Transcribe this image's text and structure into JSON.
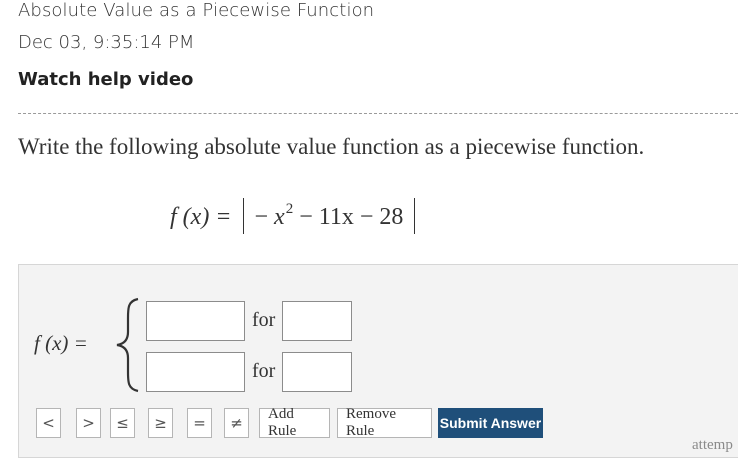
{
  "header": {
    "title": "Absolute Value as a Piecewise Function",
    "timestamp": "Dec 03, 9:35:14 PM",
    "help_link": "Watch help video"
  },
  "question": {
    "instruction": "Write the following absolute value function as a piecewise function.",
    "function_lhs": "f (x) =",
    "abs_minus": "−",
    "abs_x": "x",
    "abs_exp": "2",
    "abs_rest": "− 11x − 28"
  },
  "answer": {
    "lhs": "f (x) =",
    "rows": [
      {
        "expression_value": "",
        "for_label": "for",
        "condition_value": ""
      },
      {
        "expression_value": "",
        "for_label": "for",
        "condition_value": ""
      }
    ]
  },
  "toolbar": {
    "symbols": [
      "<",
      ">",
      "≤",
      "≥",
      "=",
      "≠"
    ],
    "add_rule": "Add Rule",
    "remove_rule": "Remove Rule",
    "submit": "Submit Answer"
  },
  "footer": {
    "attempt_text": "attemp"
  },
  "colors": {
    "submit_bg": "#1f4f7a",
    "panel_bg": "#f3f3f3"
  }
}
